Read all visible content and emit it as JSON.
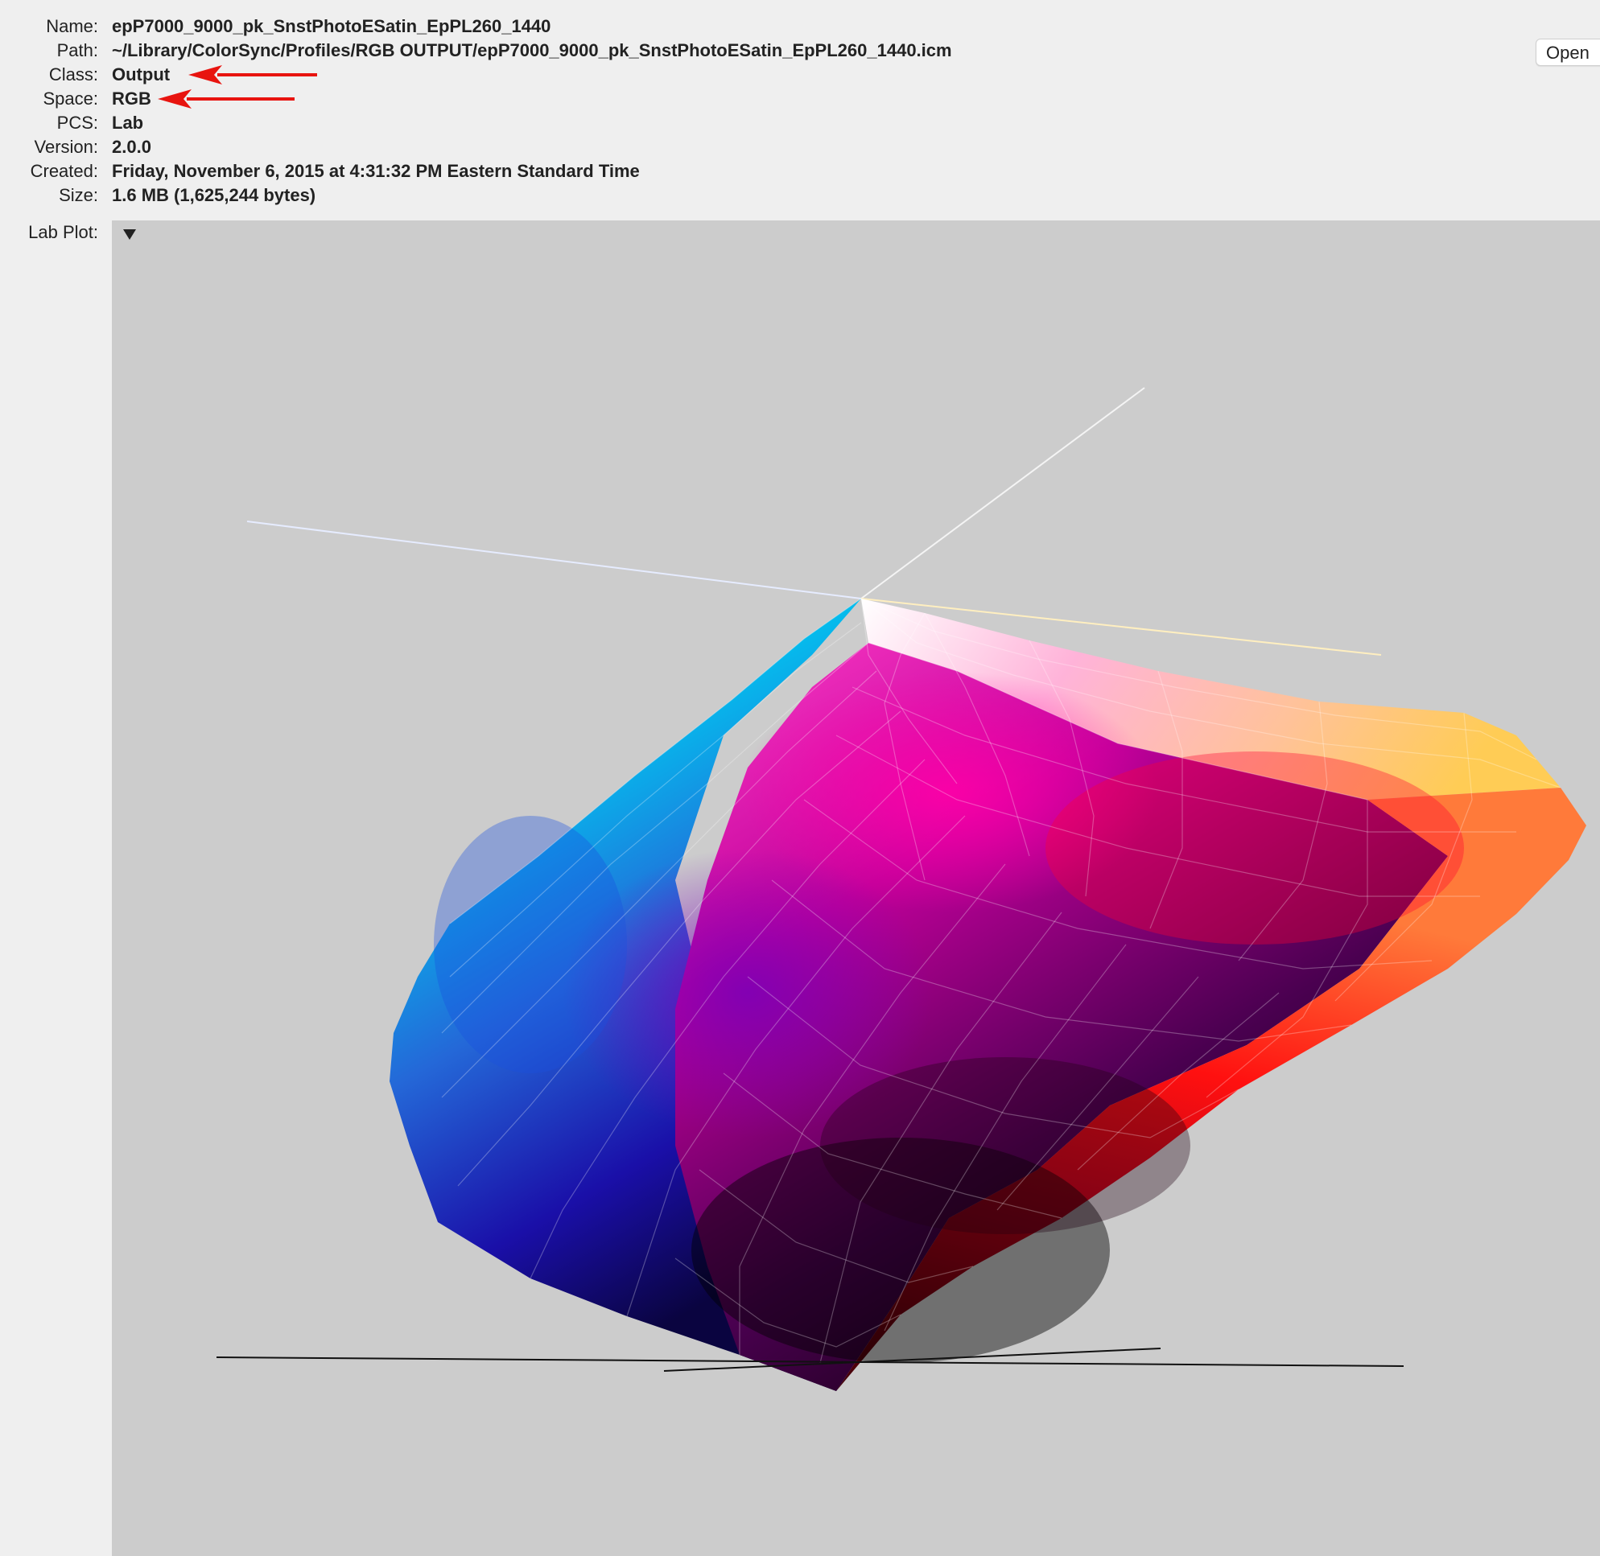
{
  "profile": {
    "fields": [
      {
        "label": "Name:",
        "value": "epP7000_9000_pk_SnstPhotoESatin_EpPL260_1440"
      },
      {
        "label": "Path:",
        "value": "~/Library/ColorSync/Profiles/RGB OUTPUT/epP7000_9000_pk_SnstPhotoESatin_EpPL260_1440.icm"
      },
      {
        "label": "Class:",
        "value": "Output"
      },
      {
        "label": "Space:",
        "value": "RGB"
      },
      {
        "label": "PCS:",
        "value": "Lab"
      },
      {
        "label": "Version:",
        "value": "2.0.0"
      },
      {
        "label": "Created:",
        "value": "Friday, November 6, 2015 at 4:31:32 PM Eastern Standard Time"
      },
      {
        "label": "Size:",
        "value": "1.6 MB (1,625,244 bytes)"
      }
    ],
    "open_label": "Open",
    "plot_label": "Lab Plot:"
  },
  "icons": {
    "disclosure": "disclosure-triangle-down-icon",
    "annotation": "red-arrow-left-icon"
  },
  "colors": {
    "annotation_arrow": "#e8140f",
    "plot_background": "#cccccc",
    "window_background": "#efefef"
  }
}
